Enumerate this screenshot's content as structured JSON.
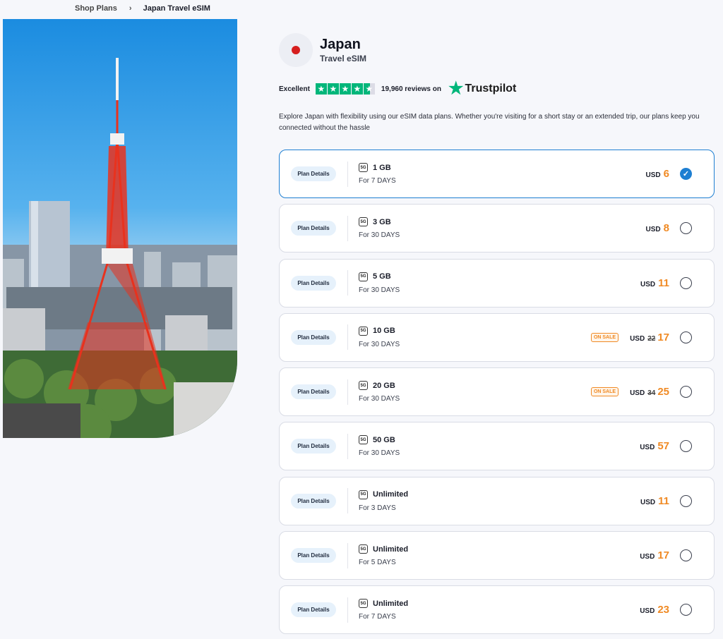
{
  "breadcrumb": {
    "items": [
      "Shop Plans",
      "Japan Travel eSIM"
    ],
    "separator": "›"
  },
  "country": {
    "name": "Japan",
    "subtitle": "Travel eSIM",
    "flag_color": "#d61e1e"
  },
  "rating": {
    "label": "Excellent",
    "stars": 4.5,
    "count_text": "19,960 reviews on",
    "brand": "Trustpilot",
    "brand_color": "#00b67a"
  },
  "description": "Explore Japan with flexibility using our eSIM data plans. Whether you're visiting for a short stay or an extended trip, our plans keep you connected without the hassle",
  "plans": [
    {
      "details_label": "Plan Details",
      "network": "5G",
      "data": "1 GB",
      "duration": "For 7 DAYS",
      "currency": "USD",
      "price": "6",
      "old_price": "",
      "sale_label": "",
      "selected": true
    },
    {
      "details_label": "Plan Details",
      "network": "5G",
      "data": "3 GB",
      "duration": "For 30 DAYS",
      "currency": "USD",
      "price": "8",
      "old_price": "",
      "sale_label": "",
      "selected": false
    },
    {
      "details_label": "Plan Details",
      "network": "5G",
      "data": "5 GB",
      "duration": "For 30 DAYS",
      "currency": "USD",
      "price": "11",
      "old_price": "",
      "sale_label": "",
      "selected": false
    },
    {
      "details_label": "Plan Details",
      "network": "5G",
      "data": "10 GB",
      "duration": "For 30 DAYS",
      "currency": "USD",
      "price": "17",
      "old_price": "22",
      "sale_label": "ON SALE",
      "selected": false
    },
    {
      "details_label": "Plan Details",
      "network": "5G",
      "data": "20 GB",
      "duration": "For 30 DAYS",
      "currency": "USD",
      "price": "25",
      "old_price": "34",
      "sale_label": "ON SALE",
      "selected": false
    },
    {
      "details_label": "Plan Details",
      "network": "5G",
      "data": "50 GB",
      "duration": "For 30 DAYS",
      "currency": "USD",
      "price": "57",
      "old_price": "",
      "sale_label": "",
      "selected": false
    },
    {
      "details_label": "Plan Details",
      "network": "5G",
      "data": "Unlimited",
      "duration": "For 3 DAYS",
      "currency": "USD",
      "price": "11",
      "old_price": "",
      "sale_label": "",
      "selected": false
    },
    {
      "details_label": "Plan Details",
      "network": "5G",
      "data": "Unlimited",
      "duration": "For 5 DAYS",
      "currency": "USD",
      "price": "17",
      "old_price": "",
      "sale_label": "",
      "selected": false
    },
    {
      "details_label": "Plan Details",
      "network": "5G",
      "data": "Unlimited",
      "duration": "For 7 DAYS",
      "currency": "USD",
      "price": "23",
      "old_price": "",
      "sale_label": "",
      "selected": false
    }
  ],
  "colors": {
    "accent_blue": "#1e7fd2",
    "price_orange": "#f08a24",
    "sky": "#3aa0e0",
    "tower_red": "#e8321e"
  },
  "icons": {
    "hero_image": "tokyo-tower-image",
    "selected_check": "check-icon",
    "network": "5g-icon"
  }
}
